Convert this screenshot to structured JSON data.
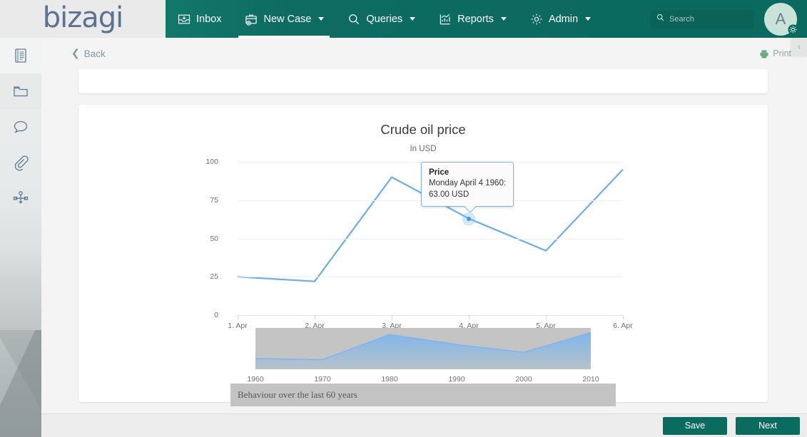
{
  "brand": {
    "logo_text": "bizagi",
    "nav_color": "#0a6a5f",
    "accent": "#7cb5ec"
  },
  "topnav": {
    "items": [
      {
        "label": "Inbox",
        "icon": "inbox-icon",
        "has_caret": false,
        "active": false
      },
      {
        "label": "New Case",
        "icon": "briefcase-plus-icon",
        "has_caret": true,
        "active": true
      },
      {
        "label": "Queries",
        "icon": "search-icon",
        "has_caret": true,
        "active": false
      },
      {
        "label": "Reports",
        "icon": "bar-chart-icon",
        "has_caret": true,
        "active": false
      },
      {
        "label": "Admin",
        "icon": "gear-icon",
        "has_caret": true,
        "active": false
      }
    ],
    "search": {
      "placeholder": "Search",
      "value": ""
    },
    "avatar": {
      "initial": "A",
      "badge_icon": "gear-icon"
    }
  },
  "sidebar": {
    "items": [
      {
        "name": "form-icon",
        "label": "Form"
      },
      {
        "name": "folder-icon",
        "label": "Documents"
      },
      {
        "name": "comment-icon",
        "label": "Comments"
      },
      {
        "name": "paperclip-icon",
        "label": "Attachments"
      },
      {
        "name": "process-diagram-icon",
        "label": "Process"
      }
    ],
    "expand_toggle": "›",
    "collapse_toggle": "‹"
  },
  "toolbar": {
    "back_label": "Back",
    "back_icon": "chevron-left-icon",
    "print_label": "Print",
    "print_icon": "printer-icon"
  },
  "chart_data": {
    "type": "line",
    "title": "Crude oil price",
    "subtitle": "In USD",
    "xlabel": "",
    "ylabel": "",
    "categories": [
      "1. Apr",
      "2. Apr",
      "3. Apr",
      "4. Apr",
      "5. Apr",
      "6. Apr"
    ],
    "values": [
      25,
      22,
      90,
      63,
      42,
      95
    ],
    "ylim": [
      0,
      100
    ],
    "yticks": [
      0,
      25,
      50,
      75,
      100
    ],
    "grid": true,
    "legend": "none",
    "line_color": "#6daee5",
    "tooltip": {
      "title": "Price",
      "line1": "Monday April 4 1960:",
      "line2": "63.00 USD",
      "point_index": 3,
      "point_value": 63
    },
    "navigator": {
      "type": "area",
      "xticks": [
        "1960",
        "1970",
        "1980",
        "1990",
        "2000",
        "2010"
      ],
      "values": [
        25,
        22,
        90,
        63,
        42,
        95
      ],
      "mask_color": "#c4c4c4",
      "area_color": "#7cb5ec"
    },
    "caption": "Behaviour over the last 60 years"
  },
  "footer": {
    "save_label": "Save",
    "next_label": "Next"
  }
}
